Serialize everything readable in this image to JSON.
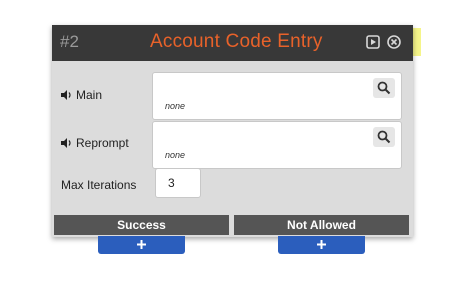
{
  "node": {
    "id": "#2",
    "title": "Account Code Entry"
  },
  "header_buttons": {
    "play_icon": "play-square-icon",
    "close_icon": "close-circle-icon"
  },
  "prompts": [
    {
      "label": "Main",
      "value": "none",
      "icon": "speaker-icon"
    },
    {
      "label": "Reprompt",
      "value": "none",
      "icon": "speaker-icon"
    }
  ],
  "max_iterations": {
    "label": "Max Iterations",
    "value": "3"
  },
  "exits": [
    {
      "label": "Success"
    },
    {
      "label": "Not Allowed"
    }
  ],
  "colors": {
    "header_bg": "#383838",
    "title": "#e8622a",
    "body_bg": "#dcdcdc",
    "exit_bg": "#555555",
    "add_button": "#2b5ebd",
    "highlight": "#f5f58a"
  }
}
